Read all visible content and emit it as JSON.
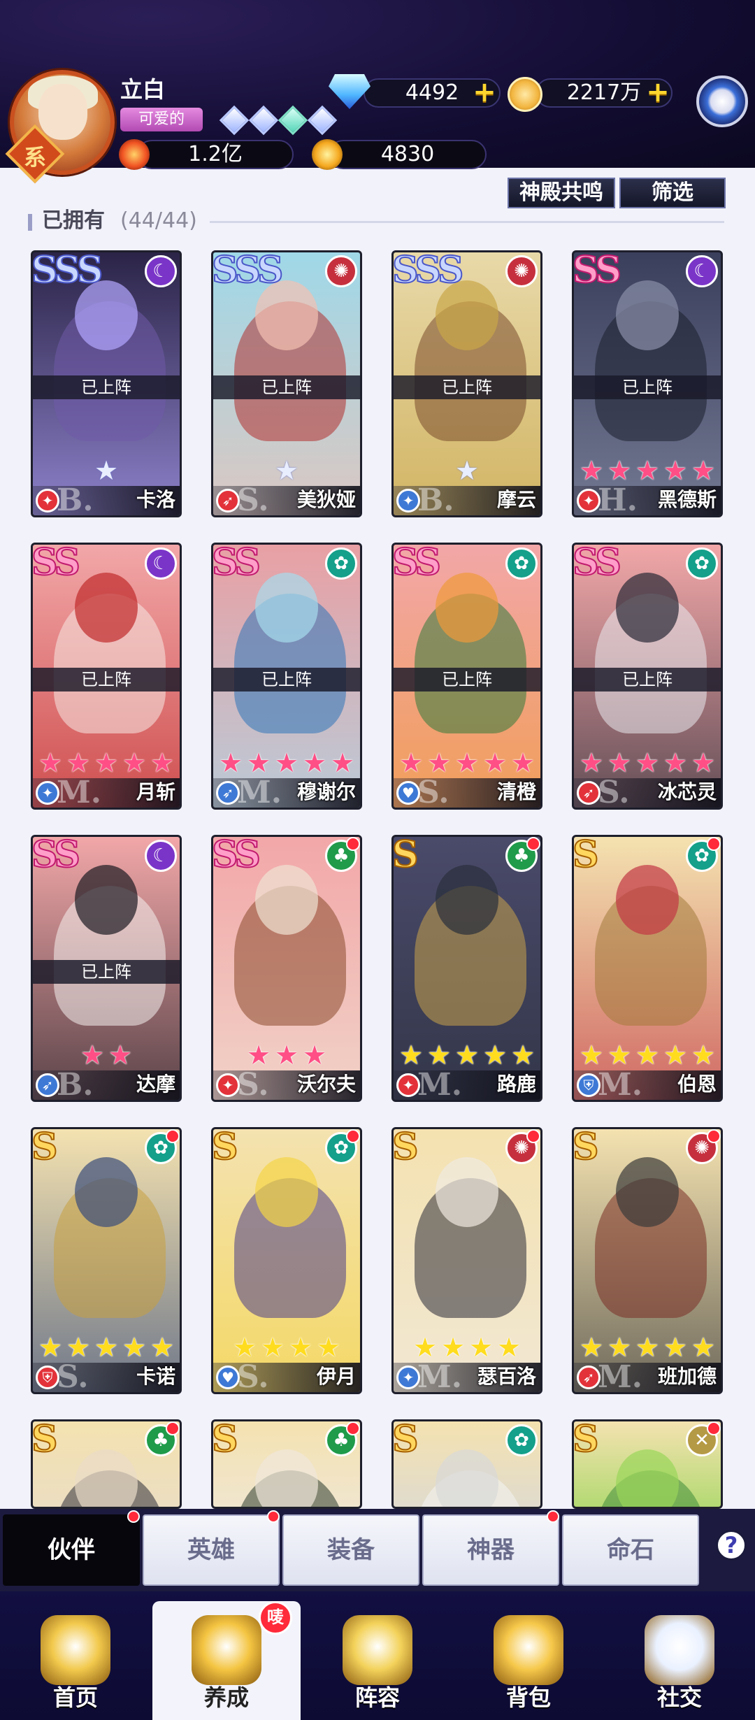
{
  "player": {
    "name": "立白",
    "title": "可爱的",
    "power": "1.2亿",
    "star_points": "4830",
    "avatar_badge": "系"
  },
  "currency": {
    "diamonds": "4492",
    "gold": "2217万"
  },
  "toolbar": {
    "resonance_label": "神殿共鸣",
    "filter_label": "筛选"
  },
  "section": {
    "label": "已拥有",
    "count": "(44/44)"
  },
  "cards": [
    {
      "name": "卡洛",
      "rank": "SSS",
      "rank_cls": "sss",
      "faction": "☾",
      "faction_color": "#7a35c8",
      "class_icon": "✦",
      "class_color": "#e3323a",
      "class_letter": "B.",
      "deployed": "已上阵",
      "star_count": 1,
      "star_color": "white",
      "bg": "#2b2447",
      "art": "#6f5aa8",
      "art2": "#b4a7ff",
      "reddot": false
    },
    {
      "name": "美狄娅",
      "rank": "SSS",
      "rank_cls": "sss",
      "faction": "✺",
      "faction_color": "#c6303e",
      "class_icon": "➶",
      "class_color": "#e3323a",
      "class_letter": "S.",
      "deployed": "已上阵",
      "star_count": 1,
      "star_color": "white",
      "bg": "#9fd8e8",
      "art": "#b0302d",
      "art2": "#f3c0b2",
      "reddot": false
    },
    {
      "name": "摩云",
      "rank": "SSS",
      "rank_cls": "sss",
      "faction": "✺",
      "faction_color": "#c6303e",
      "class_icon": "✦",
      "class_color": "#3e79d6",
      "class_letter": "B.",
      "deployed": "已上阵",
      "star_count": 1,
      "star_color": "white",
      "bg": "#e8d9a9",
      "art": "#7a4a2c",
      "art2": "#c9a648",
      "reddot": false
    },
    {
      "name": "黑德斯",
      "rank": "SS",
      "rank_cls": "ss",
      "faction": "☾",
      "faction_color": "#7a35c8",
      "class_icon": "✦",
      "class_color": "#e3323a",
      "class_letter": "H.",
      "deployed": "已上阵",
      "star_count": 5,
      "star_color": "pink",
      "bg": "#3a3f5c",
      "art": "#1c1f2e",
      "art2": "#8a8fa8",
      "reddot": false
    },
    {
      "name": "月斩",
      "rank": "SS",
      "rank_cls": "ss",
      "faction": "☾",
      "faction_color": "#7a35c8",
      "class_icon": "✦",
      "class_color": "#3e79d6",
      "class_letter": "M.",
      "deployed": "已上阵",
      "star_count": 5,
      "star_color": "pink",
      "bg": "#f2a7a8",
      "art": "#f6e9e4",
      "art2": "#c12b2b",
      "reddot": false
    },
    {
      "name": "穆谢尔",
      "rank": "SS",
      "rank_cls": "ss",
      "faction": "✿",
      "faction_color": "#14a08a",
      "class_icon": "➶",
      "class_color": "#3e79d6",
      "class_letter": "M.",
      "deployed": "已上阵",
      "star_count": 5,
      "star_color": "pink",
      "bg": "#e8a0a4",
      "art": "#2d74b8",
      "art2": "#a7dcec",
      "reddot": false
    },
    {
      "name": "清橙",
      "rank": "SS",
      "rank_cls": "ss",
      "faction": "✿",
      "faction_color": "#14a08a",
      "class_icon": "♥",
      "class_color": "#3e79d6",
      "class_letter": "S.",
      "deployed": "已上阵",
      "star_count": 5,
      "star_color": "pink",
      "bg": "#f2a7a8",
      "art": "#2f7a3a",
      "art2": "#f09a3a",
      "reddot": false
    },
    {
      "name": "冰芯灵",
      "rank": "SS",
      "rank_cls": "ss",
      "faction": "✿",
      "faction_color": "#14a08a",
      "class_icon": "➶",
      "class_color": "#e3323a",
      "class_letter": "S.",
      "deployed": "已上阵",
      "star_count": 5,
      "star_color": "pink",
      "bg": "#f2a7a8",
      "art": "#e9e9ef",
      "art2": "#2a2a36",
      "reddot": false
    },
    {
      "name": "达摩",
      "rank": "SS",
      "rank_cls": "ss",
      "faction": "☾",
      "faction_color": "#7a35c8",
      "class_icon": "➶",
      "class_color": "#3e79d6",
      "class_letter": "B.",
      "deployed": "已上阵",
      "star_count": 2,
      "star_color": "pink",
      "bg": "#f2a7a8",
      "art": "#f6f1ee",
      "art2": "#1c1b22",
      "reddot": false
    },
    {
      "name": "沃尔夫",
      "rank": "SS",
      "rank_cls": "ss",
      "faction": "♣",
      "faction_color": "#1f9b4a",
      "class_icon": "✦",
      "class_color": "#e3323a",
      "class_letter": "S.",
      "deployed": "",
      "star_count": 3,
      "star_color": "pink",
      "bg": "#f2a7a8",
      "art": "#8a4a2c",
      "art2": "#f0e3d3",
      "reddot": true
    },
    {
      "name": "路鹿",
      "rank": "S",
      "rank_cls": "s",
      "faction": "♣",
      "faction_color": "#1f9b4a",
      "class_icon": "✦",
      "class_color": "#e3323a",
      "class_letter": "M.",
      "deployed": "",
      "star_count": 5,
      "star_color": "gold",
      "bg": "#4a4a6a",
      "art": "#c8a24a",
      "art2": "#2a2f3c",
      "reddot": true
    },
    {
      "name": "伯恩",
      "rank": "S",
      "rank_cls": "s",
      "faction": "✿",
      "faction_color": "#14a08a",
      "class_icon": "⛨",
      "class_color": "#3e79d6",
      "class_letter": "M.",
      "deployed": "",
      "star_count": 5,
      "star_color": "gold",
      "bg": "#f4e2b0",
      "art": "#a37a3a",
      "art2": "#c23845",
      "reddot": true
    },
    {
      "name": "卡诺",
      "rank": "S",
      "rank_cls": "s",
      "faction": "✿",
      "faction_color": "#14a08a",
      "class_icon": "⛨",
      "class_color": "#e3323a",
      "class_letter": "S.",
      "deployed": "",
      "star_count": 5,
      "star_color": "gold",
      "bg": "#f4e2b0",
      "art": "#c9a040",
      "art2": "#3a4d7a",
      "reddot": true
    },
    {
      "name": "伊月",
      "rank": "S",
      "rank_cls": "s",
      "faction": "✿",
      "faction_color": "#14a08a",
      "class_icon": "♥",
      "class_color": "#3e79d6",
      "class_letter": "S.",
      "deployed": "",
      "star_count": 4,
      "star_color": "gold",
      "bg": "#f4e2b0",
      "art": "#4a3d8a",
      "art2": "#f4d447",
      "reddot": true
    },
    {
      "name": "瑟百洛",
      "rank": "S",
      "rank_cls": "s",
      "faction": "✺",
      "faction_color": "#c6303e",
      "class_icon": "✦",
      "class_color": "#3e79d6",
      "class_letter": "M.",
      "deployed": "",
      "star_count": 4,
      "star_color": "gold",
      "bg": "#f4e2b0",
      "art": "#2a2a36",
      "art2": "#f0e9e1",
      "reddot": true
    },
    {
      "name": "班加德",
      "rank": "S",
      "rank_cls": "s",
      "faction": "✺",
      "faction_color": "#c6303e",
      "class_icon": "➶",
      "class_color": "#e3323a",
      "class_letter": "M.",
      "deployed": "",
      "star_count": 5,
      "star_color": "gold",
      "bg": "#f4e2b0",
      "art": "#7a2d24",
      "art2": "#3a3a3a",
      "reddot": true
    },
    {
      "name": "",
      "rank": "S",
      "rank_cls": "s",
      "faction": "♣",
      "faction_color": "#1f9b4a",
      "class_icon": "",
      "class_color": "#e3323a",
      "class_letter": "",
      "deployed": "",
      "star_count": 0,
      "star_color": "gold",
      "bg": "#f4e2b0",
      "art": "#2d2d38",
      "art2": "#e9dcc8",
      "reddot": true
    },
    {
      "name": "",
      "rank": "S",
      "rank_cls": "s",
      "faction": "♣",
      "faction_color": "#1f9b4a",
      "class_icon": "",
      "class_color": "#e3323a",
      "class_letter": "",
      "deployed": "",
      "star_count": 0,
      "star_color": "gold",
      "bg": "#f4e2b0",
      "art": "#2a3a2c",
      "art2": "#efe7da",
      "reddot": true
    },
    {
      "name": "",
      "rank": "S",
      "rank_cls": "s",
      "faction": "✿",
      "faction_color": "#14a08a",
      "class_icon": "",
      "class_color": "#e3323a",
      "class_letter": "",
      "deployed": "",
      "star_count": 0,
      "star_color": "gold",
      "bg": "#f4e2b0",
      "art": "#f4f4f4",
      "art2": "#d8d8d8",
      "reddot": false
    },
    {
      "name": "",
      "rank": "S",
      "rank_cls": "s",
      "faction": "✕",
      "faction_color": "#b59a45",
      "class_icon": "",
      "class_color": "#e3323a",
      "class_letter": "",
      "deployed": "",
      "star_count": 0,
      "star_color": "gold",
      "bg": "#f4e2b0",
      "art": "#3f8c3a",
      "art2": "#9ad65a",
      "reddot": true
    }
  ],
  "tabs": [
    {
      "label": "伙伴",
      "active": true,
      "dot": true
    },
    {
      "label": "英雄",
      "active": false,
      "dot": true
    },
    {
      "label": "装备",
      "active": false,
      "dot": false
    },
    {
      "label": "神器",
      "active": false,
      "dot": true
    },
    {
      "label": "命石",
      "active": false,
      "dot": false
    }
  ],
  "help_icon": "?",
  "nav": [
    {
      "label": "首页",
      "icon": "home-icon",
      "color": "#f2c94c",
      "active": false
    },
    {
      "label": "养成",
      "icon": "star-upgrade-icon",
      "color": "#f4c542",
      "active": true,
      "badge": "唛"
    },
    {
      "label": "阵容",
      "icon": "formation-icon",
      "color": "#f3d25a",
      "active": false
    },
    {
      "label": "背包",
      "icon": "backpack-icon",
      "color": "#f6c84a",
      "active": false
    },
    {
      "label": "社交",
      "icon": "social-icon",
      "color": "#eaf1ff",
      "active": false
    }
  ]
}
